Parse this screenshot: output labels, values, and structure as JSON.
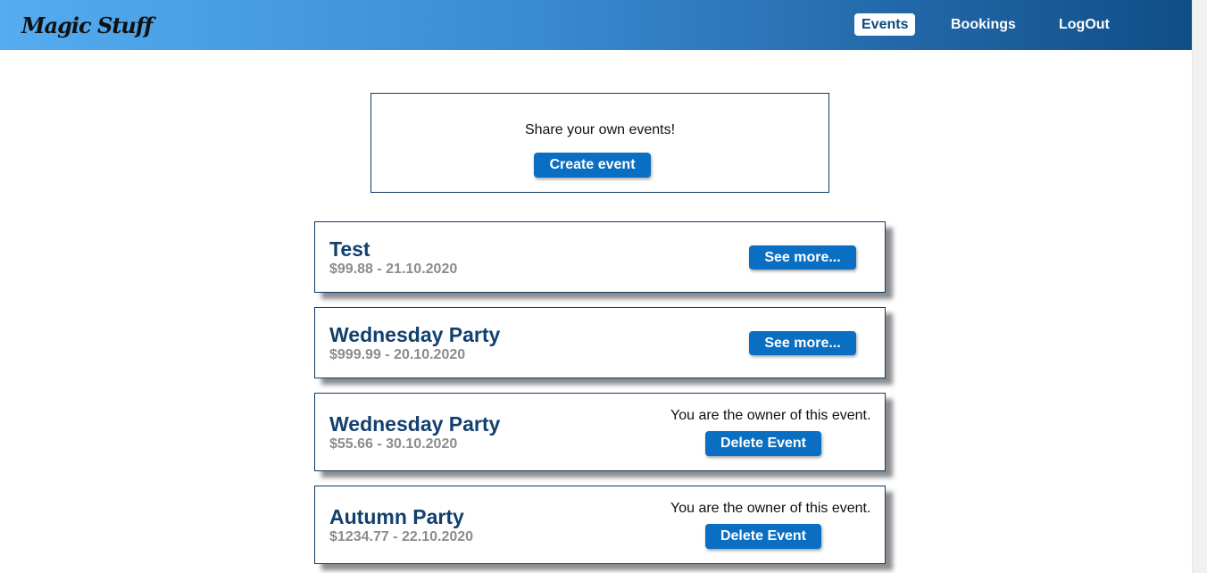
{
  "header": {
    "brand": "Magic Stuff",
    "nav": {
      "events": "Events",
      "bookings": "Bookings",
      "logout": "LogOut"
    }
  },
  "create_panel": {
    "text": "Share your own events!",
    "button": "Create event"
  },
  "events": [
    {
      "title": "Test",
      "subtitle": "$99.88 - 21.10.2020",
      "action": "See more..."
    },
    {
      "title": "Wednesday Party",
      "subtitle": "$999.99 - 20.10.2020",
      "action": "See more..."
    },
    {
      "title": "Wednesday Party",
      "subtitle": "$55.66 - 30.10.2020",
      "owner_text": "You are the owner of this event.",
      "action": "Delete Event"
    },
    {
      "title": "Autumn Party",
      "subtitle": "$1234.77 - 22.10.2020",
      "owner_text": "You are the owner of this event.",
      "action": "Delete Event"
    }
  ],
  "colors": {
    "primary": "#0a6fc2",
    "title": "#12406e",
    "subtitle": "#8c8c8c",
    "border": "#0f3b66"
  }
}
